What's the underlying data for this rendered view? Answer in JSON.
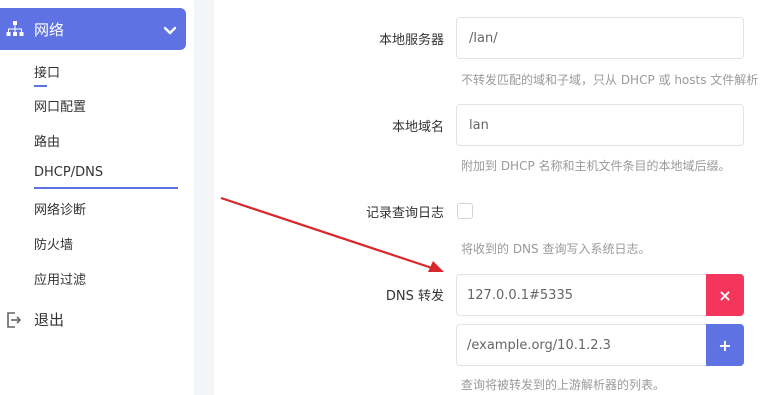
{
  "sidebar": {
    "active_menu": {
      "label": "网络",
      "icon": "network-icon"
    },
    "items": [
      {
        "label": "接口"
      },
      {
        "label": "网口配置"
      },
      {
        "label": "路由"
      },
      {
        "label": "DHCP/DNS"
      },
      {
        "label": "网络诊断"
      },
      {
        "label": "防火墙"
      },
      {
        "label": "应用过滤"
      }
    ],
    "logout": {
      "label": "退出",
      "icon": "logout-icon"
    }
  },
  "form": {
    "local_server": {
      "label": "本地服务器",
      "value": "/lan/",
      "help": "不转发匹配的域和子域，只从 DHCP 或 hosts 文件解析"
    },
    "local_domain": {
      "label": "本地域名",
      "value": "lan",
      "help": "附加到 DHCP 名称和主机文件条目的本地域后缀。"
    },
    "log_queries": {
      "label": "记录查询日志",
      "checked": false,
      "help": "将收到的 DNS 查询写入系统日志。"
    },
    "dns_forward": {
      "label": "DNS 转发",
      "entries": [
        {
          "value": "127.0.0.1#5335",
          "button": "×"
        },
        {
          "placeholder": "/example.org/10.1.2.3",
          "button": "+"
        }
      ],
      "help": "查询将被转发到的上游解析器的列表。"
    }
  },
  "colors": {
    "accent": "#5e72e4",
    "danger": "#f5365c",
    "annotation_arrow": "#d9272e"
  }
}
